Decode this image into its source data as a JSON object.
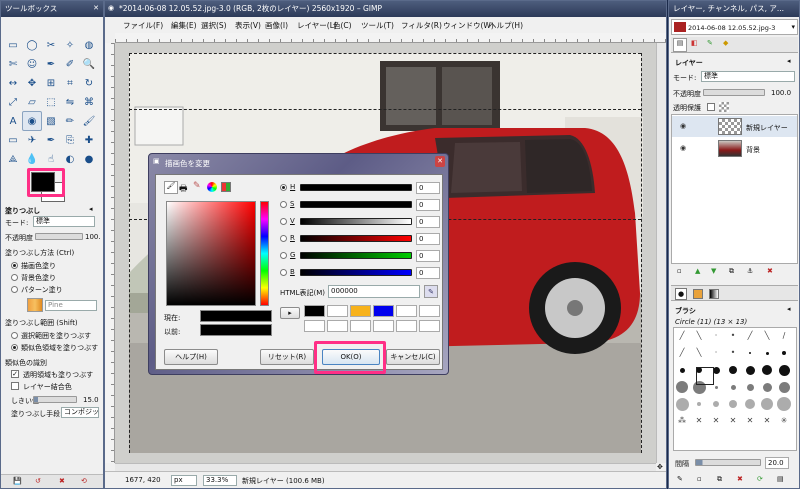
{
  "toolbox": {
    "title": "ツールボックス",
    "tools": [
      "rect-select-icon",
      "ellipse-select-icon",
      "free-select-icon",
      "fuzzy-select-icon",
      "select-by-color-icon",
      "scissors-icon",
      "foreground-select-icon",
      "paths-icon",
      "color-picker-icon",
      "zoom-icon",
      "measure-icon",
      "move-icon",
      "align-icon",
      "crop-icon",
      "rotate-icon",
      "scale-icon",
      "shear-icon",
      "perspective-icon",
      "flip-icon",
      "cage-icon",
      "text-icon",
      "bucket-fill-icon",
      "blend-icon",
      "pencil-icon",
      "paintbrush-icon",
      "eraser-icon",
      "airbrush-icon",
      "ink-icon",
      "clone-icon",
      "heal-icon",
      "perspective-clone-icon",
      "blur-icon",
      "smudge-icon",
      "dodge-icon",
      "burn-icon"
    ],
    "fg_color": "#000000",
    "bg_color": "#ffffff",
    "options": {
      "header": "塗りつぶし",
      "mode_label": "モード:",
      "mode_value": "標準",
      "opacity_label": "不透明度",
      "opacity_value": "100.",
      "fill_type_label": "塗りつぶし方法 (Ctrl)",
      "fill_fg": "描画色塗り",
      "fill_bg": "背景色塗り",
      "fill_pattern": "パターン塗り",
      "pattern_name": "Pine",
      "area_label": "塗りつぶし範囲 (Shift)",
      "area_selection": "選択範囲を塗りつぶす",
      "area_similar": "類似色領域を塗りつぶす",
      "finding_label": "類似色の識別",
      "transparent_areas": "透明領域も塗りつぶす",
      "sample_merged": "レイヤー結合色",
      "threshold_label": "しきい値",
      "threshold_value": "15.0",
      "fill_by_label": "塗りつぶし手段:",
      "fill_by_value": "コンポジット"
    }
  },
  "image_window": {
    "title": "*2014-06-08 12.05.52.jpg-3.0 (RGB, 2枚のレイヤー) 2560x1920 – GIMP",
    "menu": [
      "ファイル(F)",
      "編集(E)",
      "選択(S)",
      "表示(V)",
      "画像(I)",
      "レイヤー(L)",
      "色(C)",
      "ツール(T)",
      "フィルタ(R)",
      "ウィンドウ(W)",
      "ヘルプ(H)"
    ],
    "status": {
      "coords": "1677, 420",
      "unit": "px",
      "zoom": "33.3%",
      "layer_info": "新規レイヤー (100.6 MB)"
    }
  },
  "dialog": {
    "title": "描画色を変更",
    "channels": [
      {
        "label": "H",
        "value": "0",
        "color": "#000000"
      },
      {
        "label": "S",
        "value": "0",
        "color": "#000000"
      },
      {
        "label": "V",
        "value": "0",
        "color": "#ffffff"
      },
      {
        "label": "R",
        "value": "0",
        "color": "#ff0000"
      },
      {
        "label": "G",
        "value": "0",
        "color": "#00cc00"
      },
      {
        "label": "B",
        "value": "0",
        "color": "#0000ff"
      }
    ],
    "html_label": "HTML表記(M)",
    "html_value": "000000",
    "current_label": "現在:",
    "old_label": "以前:",
    "history_colors": [
      "#000000",
      "#ffffff",
      "#f7b21b",
      "#0000ee",
      "#ffffff",
      "#ffffff",
      "#ffffff",
      "#ffffff",
      "#ffffff",
      "#ffffff",
      "#ffffff",
      "#ffffff"
    ],
    "buttons": {
      "help": "ヘルプ(H)",
      "reset": "リセット(R)",
      "ok": "OK(O)",
      "cancel": "キャンセル(C)"
    }
  },
  "layers_dock": {
    "title": "レイヤー, チャンネル, パス, ア...",
    "image_name": "2014-06-08 12.05.52.jpg-3",
    "panel_title": "レイヤー",
    "mode_label": "モード:",
    "mode_value": "標準",
    "opacity_label": "不透明度",
    "opacity_value": "100.0",
    "lock_label": "透明保護",
    "layers": [
      {
        "name": "新規レイヤー",
        "selected": true
      },
      {
        "name": "背景",
        "selected": false
      }
    ],
    "brushes_title": "ブラシ",
    "brush_name": "Circle (11) (13 × 13)",
    "spacing_label": "間隔",
    "spacing_value": "20.0"
  },
  "colors": {
    "accent": "#ff2f86",
    "car_red": "#c01c1e"
  }
}
